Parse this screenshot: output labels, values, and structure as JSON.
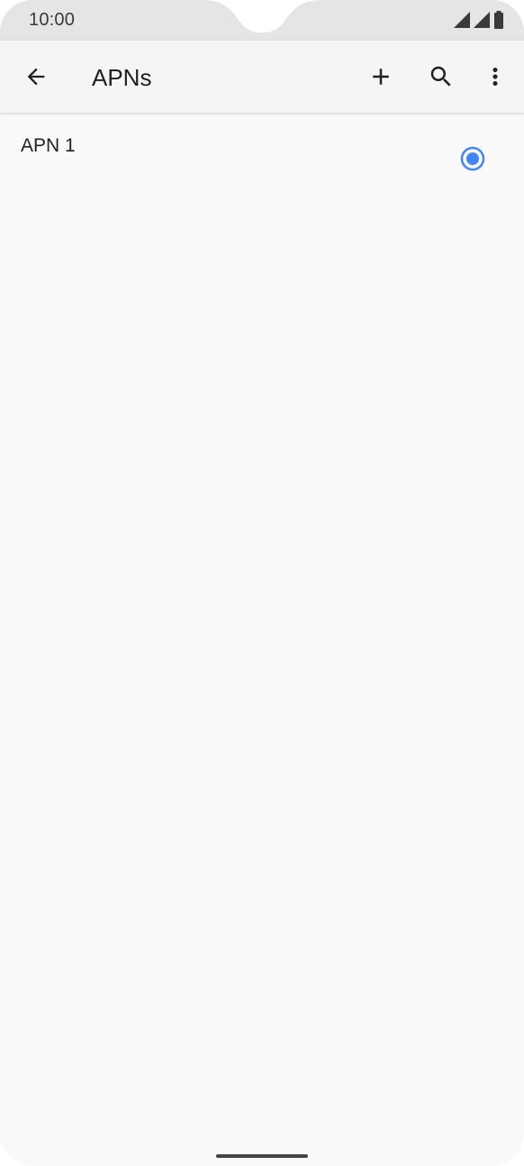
{
  "status_bar": {
    "time": "10:00",
    "icons": [
      "signal-icon",
      "signal-icon",
      "battery-icon"
    ]
  },
  "app_bar": {
    "title": "APNs",
    "back_icon": "arrow-back-icon",
    "actions": [
      "add-icon",
      "search-icon",
      "more-vert-icon"
    ]
  },
  "apn_list": [
    {
      "name": "APN 1",
      "selected": true
    }
  ],
  "colors": {
    "accent": "#4285f4",
    "status_bar_bg": "#e5e5e5",
    "app_bar_bg": "#f5f5f5",
    "page_bg": "#f9f9f9",
    "text_primary": "#202124"
  }
}
